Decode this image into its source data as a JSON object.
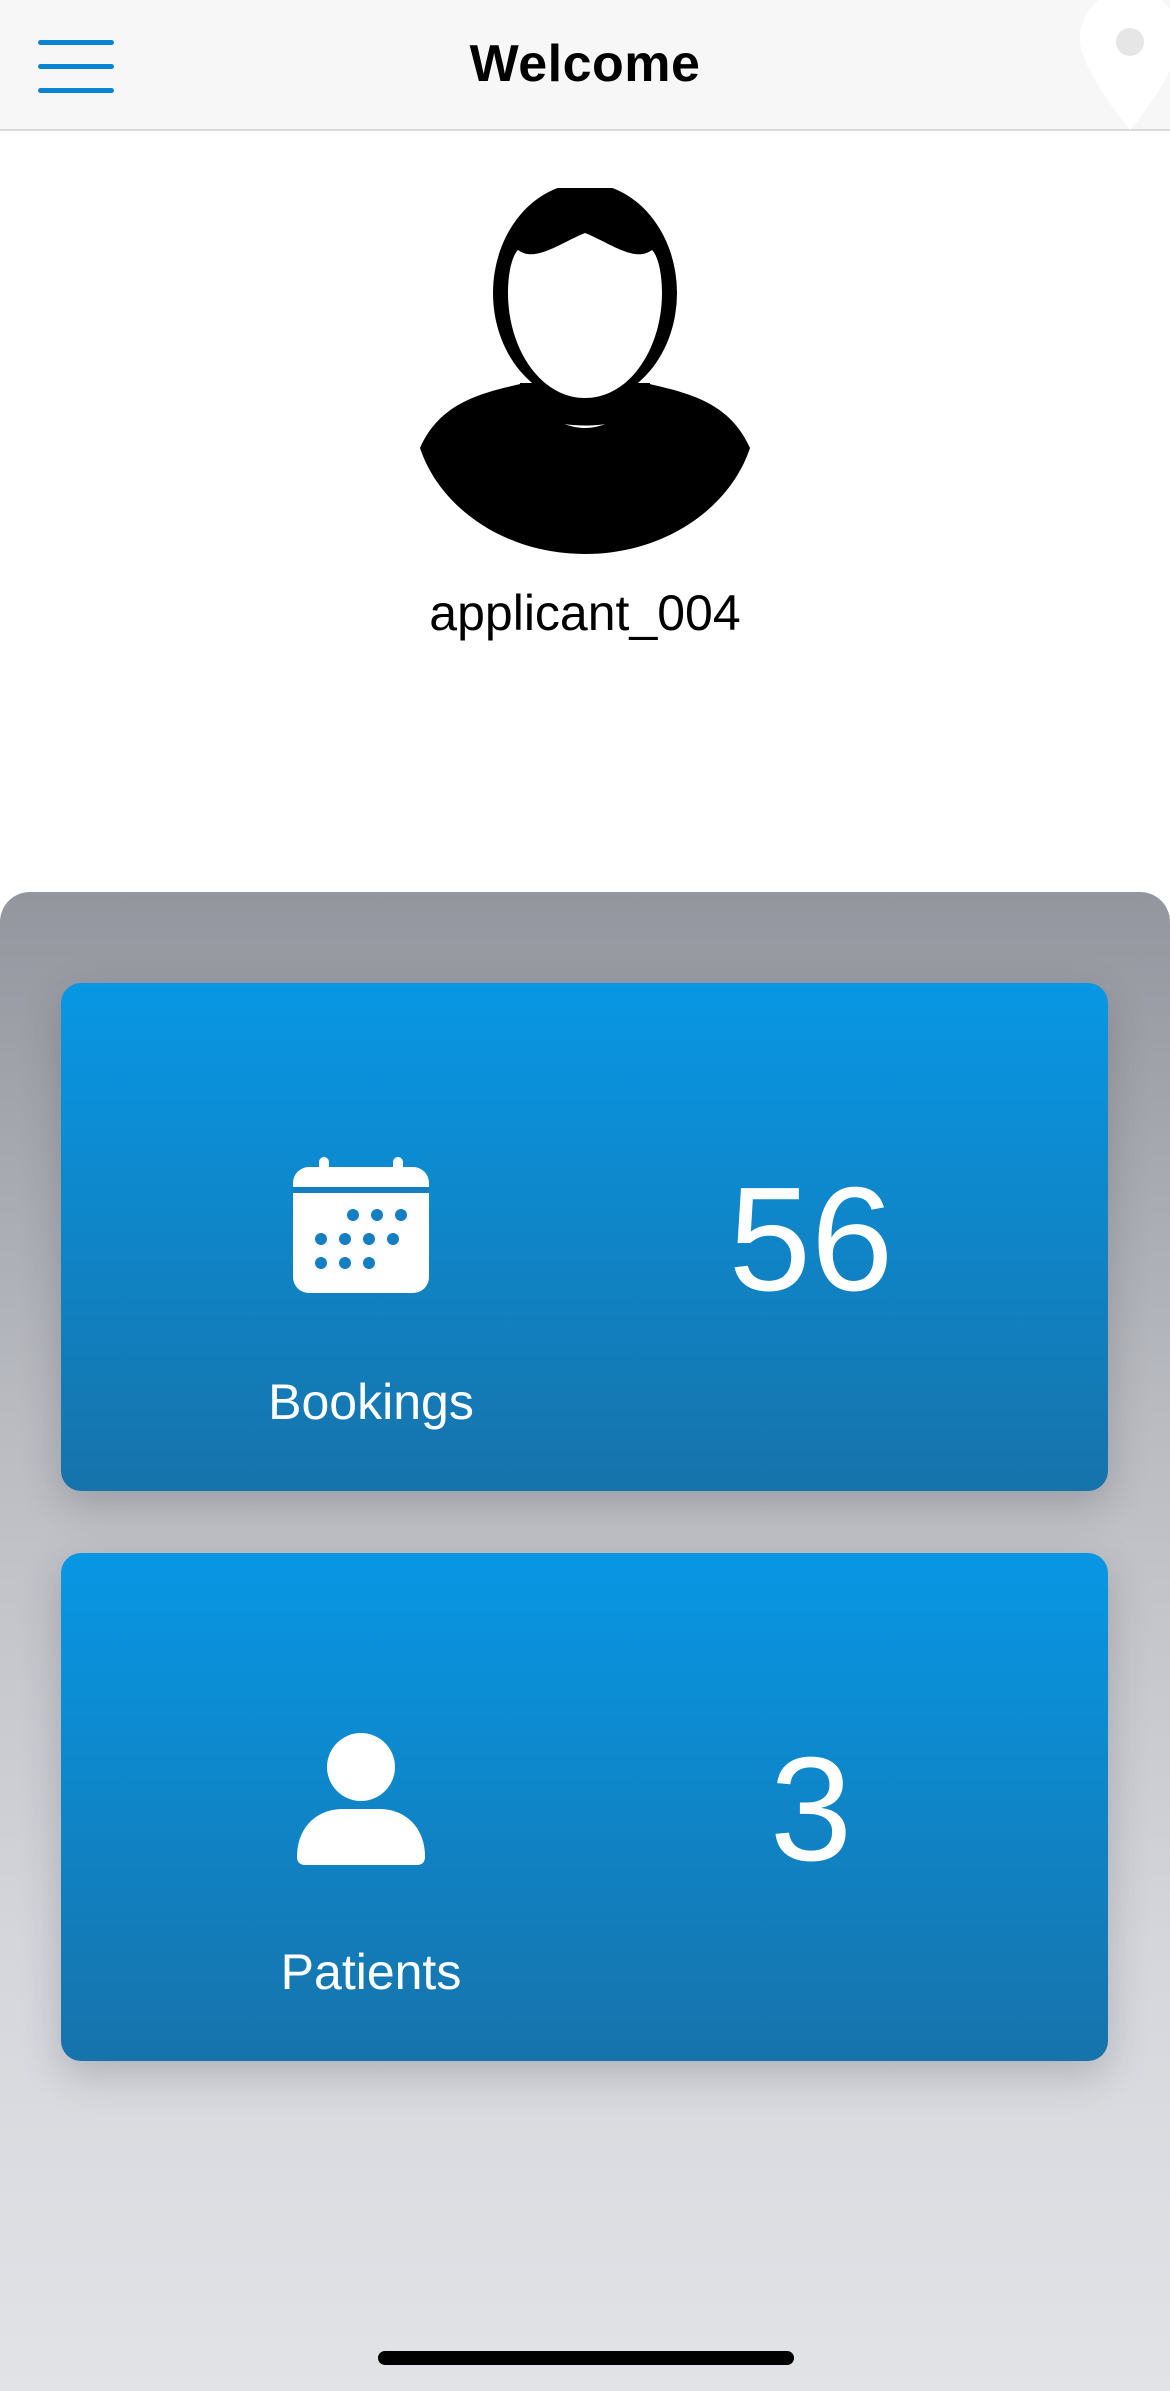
{
  "navbar": {
    "title": "Welcome",
    "menu_icon": "hamburger-menu-icon",
    "location_icon": "map-pin-icon",
    "accent_color": "#0a84d0"
  },
  "profile": {
    "avatar_icon": "user-avatar-icon",
    "username": "applicant_004"
  },
  "cards": {
    "bookings": {
      "icon": "calendar-icon",
      "label": "Bookings",
      "value": "56"
    },
    "patients": {
      "icon": "person-icon",
      "label": "Patients",
      "value": "3"
    }
  },
  "colors": {
    "card_gradient_top": "#0897e4",
    "card_gradient_bottom": "#1673ab",
    "panel_top": "#93969e",
    "panel_bottom": "#e2e3e7"
  }
}
